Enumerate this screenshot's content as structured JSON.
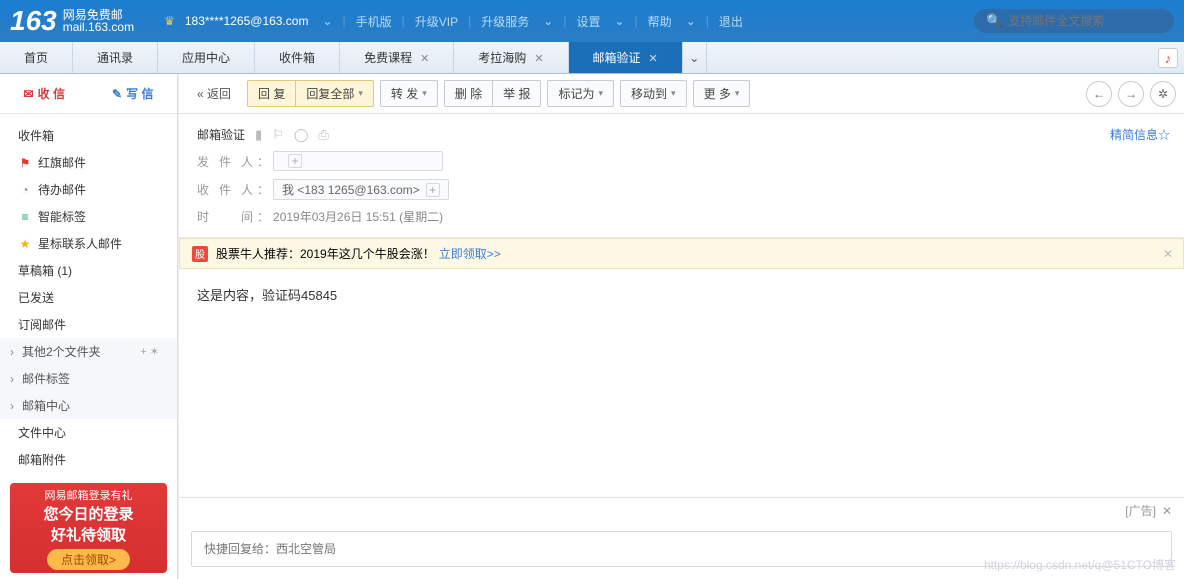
{
  "brand": {
    "num": "163",
    "name": "网易免费邮",
    "domain": "mail.163.com"
  },
  "header": {
    "user": "183****1265@163.com",
    "links": [
      "手机版",
      "升级VIP",
      "升级服务",
      "设置",
      "帮助",
      "退出"
    ],
    "search_placeholder": "支持邮件全文搜索"
  },
  "tabs": [
    {
      "label": "首页",
      "close": false
    },
    {
      "label": "通讯录",
      "close": false
    },
    {
      "label": "应用中心",
      "close": false
    },
    {
      "label": "收件箱",
      "close": false
    },
    {
      "label": "免费课程",
      "close": true
    },
    {
      "label": "考拉海购",
      "close": true
    },
    {
      "label": "邮箱验证",
      "close": true,
      "active": true
    }
  ],
  "side": {
    "receive": "收 信",
    "compose": "写 信",
    "folders": [
      {
        "label": "收件箱"
      },
      {
        "label": "红旗邮件",
        "icon": "🚩",
        "color": "#e33"
      },
      {
        "label": "待办邮件",
        "icon": "◔",
        "color": "#888"
      },
      {
        "label": "智能标签",
        "icon": "≡",
        "color": "#18a05e"
      },
      {
        "label": "星标联系人邮件",
        "icon": "★",
        "color": "#f5b400"
      },
      {
        "label": "草稿箱 (1)"
      },
      {
        "label": "已发送"
      },
      {
        "label": "订阅邮件"
      }
    ],
    "groups": [
      {
        "label": "其他2个文件夹",
        "ops": "+ ✶"
      },
      {
        "label": "邮件标签"
      },
      {
        "label": "邮箱中心"
      }
    ],
    "more": [
      {
        "label": "文件中心"
      },
      {
        "label": "邮箱附件"
      }
    ],
    "promo": {
      "l1": "网易邮箱登录有礼",
      "l2": "您今日的登录",
      "l3": "好礼待领取",
      "btn": "点击领取>"
    }
  },
  "toolbar": {
    "back": "« 返回",
    "reply": "回 复",
    "reply_all": "回复全部",
    "forward": "转 发",
    "delete": "删 除",
    "report": "举 报",
    "mark": "标记为",
    "move": "移动到",
    "more": "更 多"
  },
  "mail": {
    "subject": "邮箱验证",
    "sender_label": "发件人",
    "sender": "",
    "recipient_label": "收件人",
    "recipient": "我 <183        1265@163.com>",
    "time_label": "时   间",
    "time": "2019年03月26日 15:51 (星期二)",
    "concise": "精简信息☆",
    "banner_text": "股票牛人推荐：2019年这几个牛股会涨！",
    "banner_link": "立即领取>>",
    "body": "这是内容，验证码45845",
    "ad": "[广告]",
    "quick_reply_placeholder": "快捷回复给：西北空管局"
  },
  "watermark": "https://blog.csdn.net/q@51CTO博客"
}
